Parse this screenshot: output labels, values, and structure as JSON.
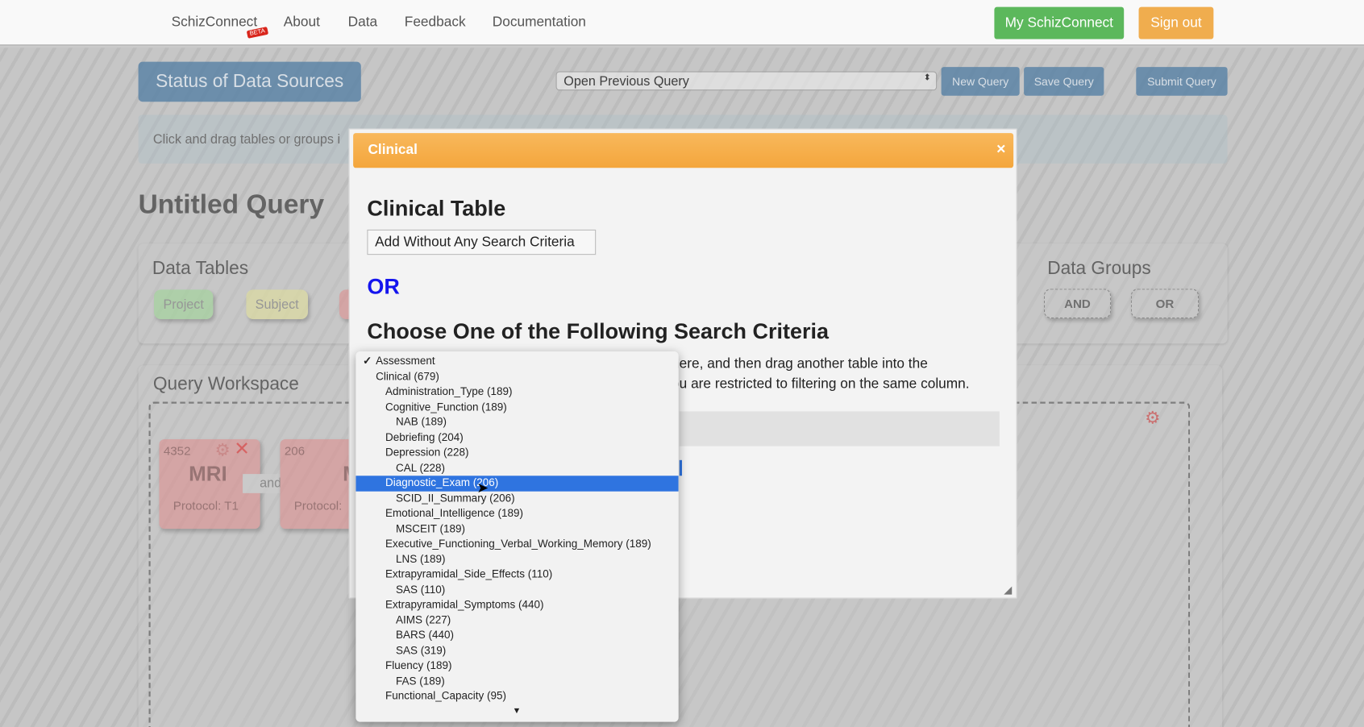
{
  "nav": {
    "brand": "SchizConnect",
    "beta": "BETA",
    "links": [
      "About",
      "Data",
      "Feedback",
      "Documentation"
    ],
    "my_button": "My SchizConnect",
    "signout_button": "Sign out"
  },
  "colors": {
    "green": "#5cb85c",
    "orange": "#f0ad4e",
    "header_orange": "#f6ac4a",
    "blue": "#4f7ca3",
    "or_blue": "#1414ee",
    "selected": "#2f74e0"
  },
  "toolbar": {
    "status_button": "Status of Data Sources",
    "query_select": "Open Previous Query",
    "new_query": "New Query",
    "save_query": "Save Query",
    "submit_query": "Submit Query"
  },
  "info": "Click and drag tables or groups i",
  "query_title": "Untitled Query",
  "data_tables": {
    "title": "Data Tables",
    "chips": [
      "Project",
      "Subject"
    ]
  },
  "data_groups": {
    "title": "Data Groups",
    "and": "AND",
    "or": "OR"
  },
  "workspace": {
    "title": "Query Workspace",
    "cards": [
      {
        "count": "4352",
        "name": "MRI",
        "protocol": "Protocol: T1"
      },
      {
        "count": "206",
        "name": "M",
        "protocol": "Protocol:"
      }
    ],
    "connector": "and"
  },
  "modal": {
    "title": "Clinical",
    "close": "×",
    "table_heading": "Clinical Table",
    "add_button": "Add Without Any Search Criteria",
    "or": "OR",
    "choose_heading": "Choose One of the Following Search Criteria",
    "text_line1": "here, and then drag another table into the",
    "text_line2": "ou are restricted to filtering on the same column."
  },
  "dropdown": {
    "items": [
      {
        "label": "Assessment",
        "level": 0,
        "checked": true
      },
      {
        "label": "Clinical (679)",
        "level": 0
      },
      {
        "label": "Administration_Type (189)",
        "level": 1
      },
      {
        "label": "Cognitive_Function (189)",
        "level": 1
      },
      {
        "label": "NAB (189)",
        "level": 2
      },
      {
        "label": "Debriefing (204)",
        "level": 1
      },
      {
        "label": "Depression (228)",
        "level": 1
      },
      {
        "label": "CAL (228)",
        "level": 2
      },
      {
        "label": "Diagnostic_Exam (206)",
        "level": 1,
        "selected": true
      },
      {
        "label": "SCID_II_Summary (206)",
        "level": 2
      },
      {
        "label": "Emotional_Intelligence (189)",
        "level": 1
      },
      {
        "label": "MSCEIT (189)",
        "level": 2
      },
      {
        "label": "Executive_Functioning_Verbal_Working_Memory (189)",
        "level": 1
      },
      {
        "label": "LNS (189)",
        "level": 2
      },
      {
        "label": "Extrapyramidal_Side_Effects (110)",
        "level": 1
      },
      {
        "label": "SAS (110)",
        "level": 2
      },
      {
        "label": "Extrapyramidal_Symptoms (440)",
        "level": 1
      },
      {
        "label": "AIMS (227)",
        "level": 2
      },
      {
        "label": "BARS (440)",
        "level": 2
      },
      {
        "label": "SAS (319)",
        "level": 2
      },
      {
        "label": "Fluency (189)",
        "level": 1
      },
      {
        "label": "FAS (189)",
        "level": 2
      },
      {
        "label": "Functional_Capacity (95)",
        "level": 1
      }
    ],
    "scroll_icon": "triangle-down-icon"
  }
}
